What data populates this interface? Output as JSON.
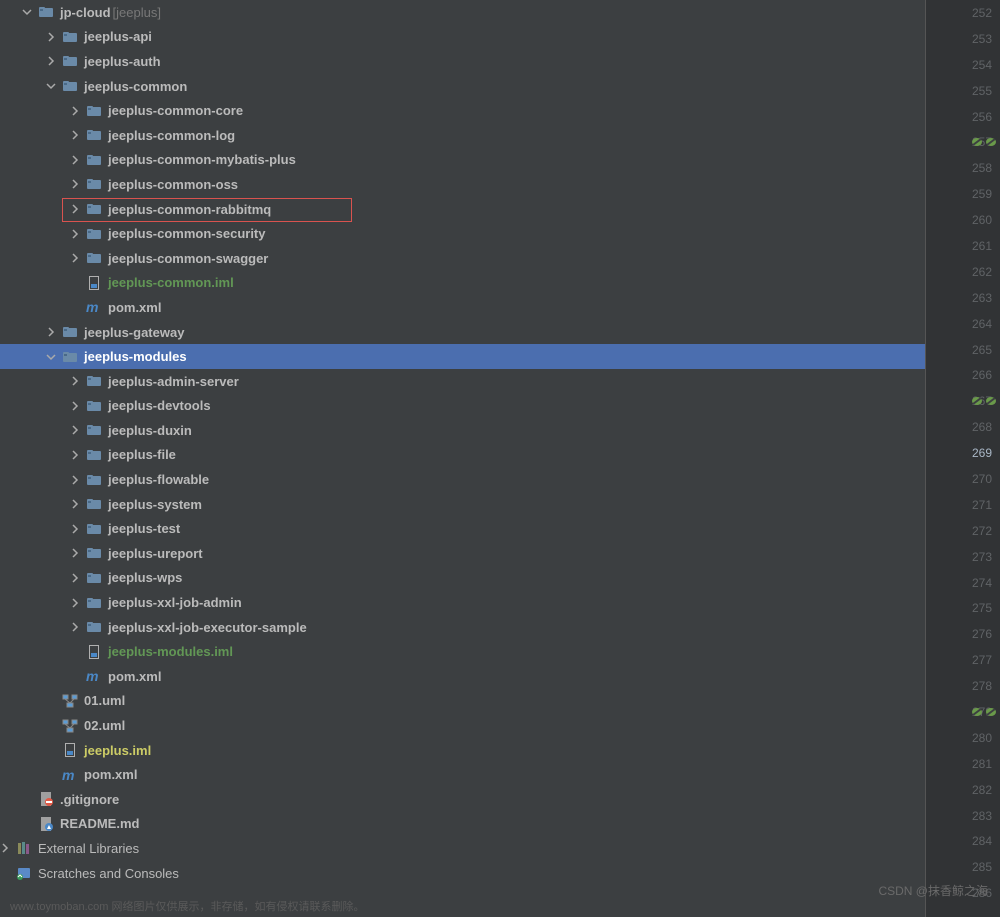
{
  "tree": [
    {
      "indent": 22,
      "chev": "down",
      "icon": "folder",
      "label": "jp-cloud",
      "secondary": "[jeeplus]"
    },
    {
      "indent": 46,
      "chev": "right",
      "icon": "folder",
      "label": "jeeplus-api"
    },
    {
      "indent": 46,
      "chev": "right",
      "icon": "folder",
      "label": "jeeplus-auth"
    },
    {
      "indent": 46,
      "chev": "down",
      "icon": "folder",
      "label": "jeeplus-common"
    },
    {
      "indent": 70,
      "chev": "right",
      "icon": "folder",
      "label": "jeeplus-common-core"
    },
    {
      "indent": 70,
      "chev": "right",
      "icon": "folder",
      "label": "jeeplus-common-log"
    },
    {
      "indent": 70,
      "chev": "right",
      "icon": "folder",
      "label": "jeeplus-common-mybatis-plus"
    },
    {
      "indent": 70,
      "chev": "right",
      "icon": "folder",
      "label": "jeeplus-common-oss"
    },
    {
      "indent": 70,
      "chev": "right",
      "icon": "folder",
      "label": "jeeplus-common-rabbitmq",
      "boxed": true
    },
    {
      "indent": 70,
      "chev": "right",
      "icon": "folder",
      "label": "jeeplus-common-security"
    },
    {
      "indent": 70,
      "chev": "right",
      "icon": "folder",
      "label": "jeeplus-common-swagger"
    },
    {
      "indent": 70,
      "chev": "none",
      "icon": "iml",
      "label": "jeeplus-common.iml",
      "color": "green"
    },
    {
      "indent": 70,
      "chev": "none",
      "icon": "pom",
      "label": "pom.xml"
    },
    {
      "indent": 46,
      "chev": "right",
      "icon": "folder",
      "label": "jeeplus-gateway"
    },
    {
      "indent": 46,
      "chev": "down",
      "icon": "folder",
      "label": "jeeplus-modules",
      "selected": true
    },
    {
      "indent": 70,
      "chev": "right",
      "icon": "folder",
      "label": "jeeplus-admin-server"
    },
    {
      "indent": 70,
      "chev": "right",
      "icon": "folder",
      "label": "jeeplus-devtools"
    },
    {
      "indent": 70,
      "chev": "right",
      "icon": "folder",
      "label": "jeeplus-duxin"
    },
    {
      "indent": 70,
      "chev": "right",
      "icon": "folder",
      "label": "jeeplus-file"
    },
    {
      "indent": 70,
      "chev": "right",
      "icon": "folder",
      "label": "jeeplus-flowable"
    },
    {
      "indent": 70,
      "chev": "right",
      "icon": "folder",
      "label": "jeeplus-system"
    },
    {
      "indent": 70,
      "chev": "right",
      "icon": "folder",
      "label": "jeeplus-test"
    },
    {
      "indent": 70,
      "chev": "right",
      "icon": "folder",
      "label": "jeeplus-ureport"
    },
    {
      "indent": 70,
      "chev": "right",
      "icon": "folder",
      "label": "jeeplus-wps"
    },
    {
      "indent": 70,
      "chev": "right",
      "icon": "folder",
      "label": "jeeplus-xxl-job-admin"
    },
    {
      "indent": 70,
      "chev": "right",
      "icon": "folder",
      "label": "jeeplus-xxl-job-executor-sample"
    },
    {
      "indent": 70,
      "chev": "none",
      "icon": "iml",
      "label": "jeeplus-modules.iml",
      "color": "green"
    },
    {
      "indent": 70,
      "chev": "none",
      "icon": "pom",
      "label": "pom.xml"
    },
    {
      "indent": 46,
      "chev": "none",
      "icon": "uml",
      "label": "01.uml"
    },
    {
      "indent": 46,
      "chev": "none",
      "icon": "uml",
      "label": "02.uml"
    },
    {
      "indent": 46,
      "chev": "none",
      "icon": "iml",
      "label": "jeeplus.iml",
      "color": "olive"
    },
    {
      "indent": 46,
      "chev": "none",
      "icon": "pom",
      "label": "pom.xml"
    },
    {
      "indent": 22,
      "chev": "none",
      "icon": "gitignore",
      "label": ".gitignore"
    },
    {
      "indent": 22,
      "chev": "none",
      "icon": "md",
      "label": "README.md"
    },
    {
      "indent": 0,
      "chev": "right",
      "icon": "lib",
      "label": "External Libraries",
      "weight": "normal"
    },
    {
      "indent": 0,
      "chev": "none",
      "icon": "scratch",
      "label": "Scratches and Consoles",
      "weight": "normal"
    }
  ],
  "gutter": {
    "start": 252,
    "end": 286,
    "current": 269,
    "marks": {
      "257": "gg",
      "267": "gg",
      "279": "gg"
    }
  },
  "footer": "www.toymoban.com 网络图片仅供展示，非存储，如有侵权请联系删除。",
  "watermark": "CSDN @抹香鲸之海"
}
